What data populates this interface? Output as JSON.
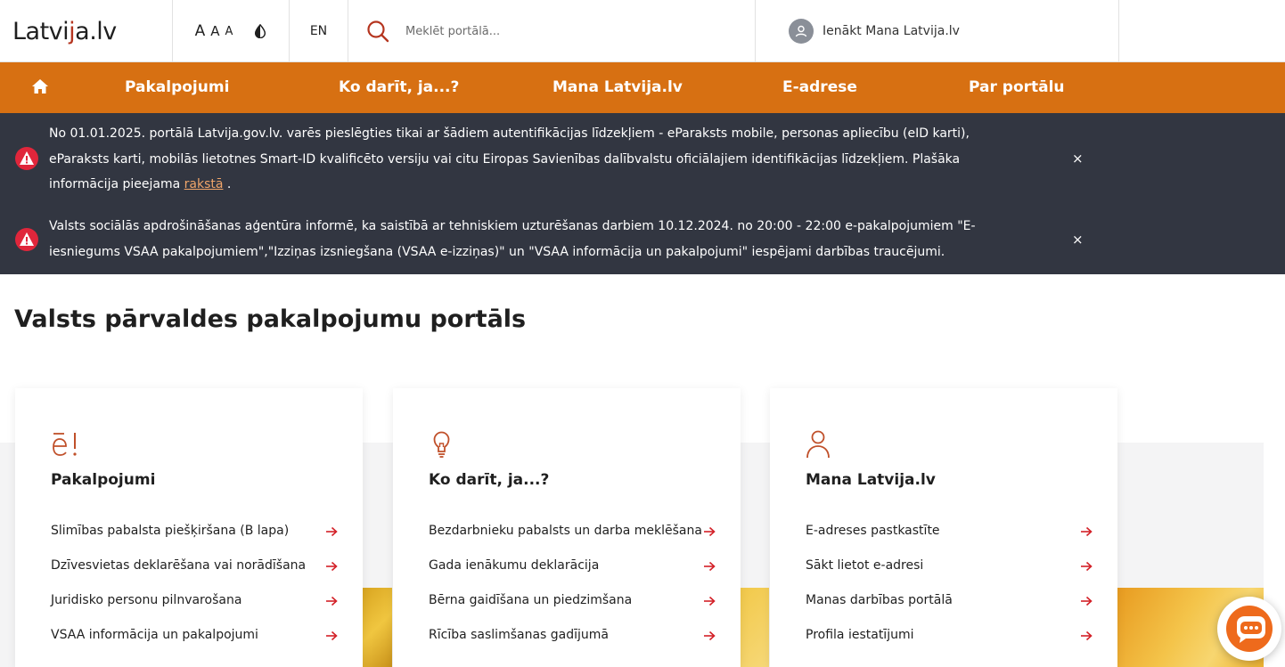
{
  "header": {
    "logo_text_1": "Latvi",
    "logo_text_accent": "j",
    "logo_text_2": "a.lv",
    "font_sizes": [
      "A",
      "A",
      "A"
    ],
    "language": "EN",
    "search_placeholder": "Meklēt portālā...",
    "login_label": "Ienākt Mana Latvija.lv"
  },
  "nav": {
    "home_icon": "home-icon",
    "items": [
      "Pakalpojumi",
      "Ko darīt, ja...?",
      "Mana Latvija.lv",
      "E-adrese",
      "Par portālu"
    ]
  },
  "alerts": [
    {
      "text_before_link": "No 01.01.2025. portālā Latvija.gov.lv. varēs pieslēgties tikai ar šādiem autentifikācijas līdzekļiem - eParaksts mobile, personas apliecību (eID karti), eParaksts karti, mobilās lietotnes Smart-ID kvalificēto versiju vai citu Eiropas Savienības dalībvalstu oficiālajiem identifikācijas līdzekļiem. Plašāka informācija pieejama ",
      "link_text": "rakstā",
      "text_after_link": " .",
      "close": "×"
    },
    {
      "text": "Valsts sociālās apdrošināšanas aģentūra informē, ka saistībā ar tehniskiem uzturēšanas darbiem 10.12.2024. no 20:00 - 22:00 e-pakalpojumiem \"E-iesniegums VSAA pakalpojumiem\",\"Izziņas izsniegšana (VSAA e-izziņas)\" un \"VSAA informācija un pakalpojumi\" iespējami darbības traucējumi.",
      "close": "×"
    }
  ],
  "page_title": "Valsts pārvaldes pakalpojumu portāls",
  "cards": [
    {
      "icon": "e-service-icon",
      "title": "Pakalpojumi",
      "links": [
        "Slimības pabalsta piešķiršana (B lapa)",
        "Dzīvesvietas deklarēšana vai norādīšana",
        "Juridisko personu pilnvarošana",
        "VSAA informācija un pakalpojumi"
      ]
    },
    {
      "icon": "lightbulb-icon",
      "title": "Ko darīt, ja...?",
      "links": [
        "Bezdarbnieku pabalsts un darba meklēšana",
        "Gada ienākumu deklarācija",
        "Bērna gaidīšana un piedzimšana",
        "Rīcība saslimšanas gadījumā"
      ]
    },
    {
      "icon": "person-icon",
      "title": "Mana Latvija.lv",
      "links": [
        "E-adreses pastkastīte",
        "Sākt lietot e-adresi",
        "Manas darbības portālā",
        "Profila iestatījumi"
      ]
    }
  ],
  "colors": {
    "brand_orange": "#d77012",
    "alert_bg": "#323641",
    "accent_red": "#b5351f",
    "alert_icon_red": "#e0263b",
    "link_orange": "#f0a56a"
  }
}
